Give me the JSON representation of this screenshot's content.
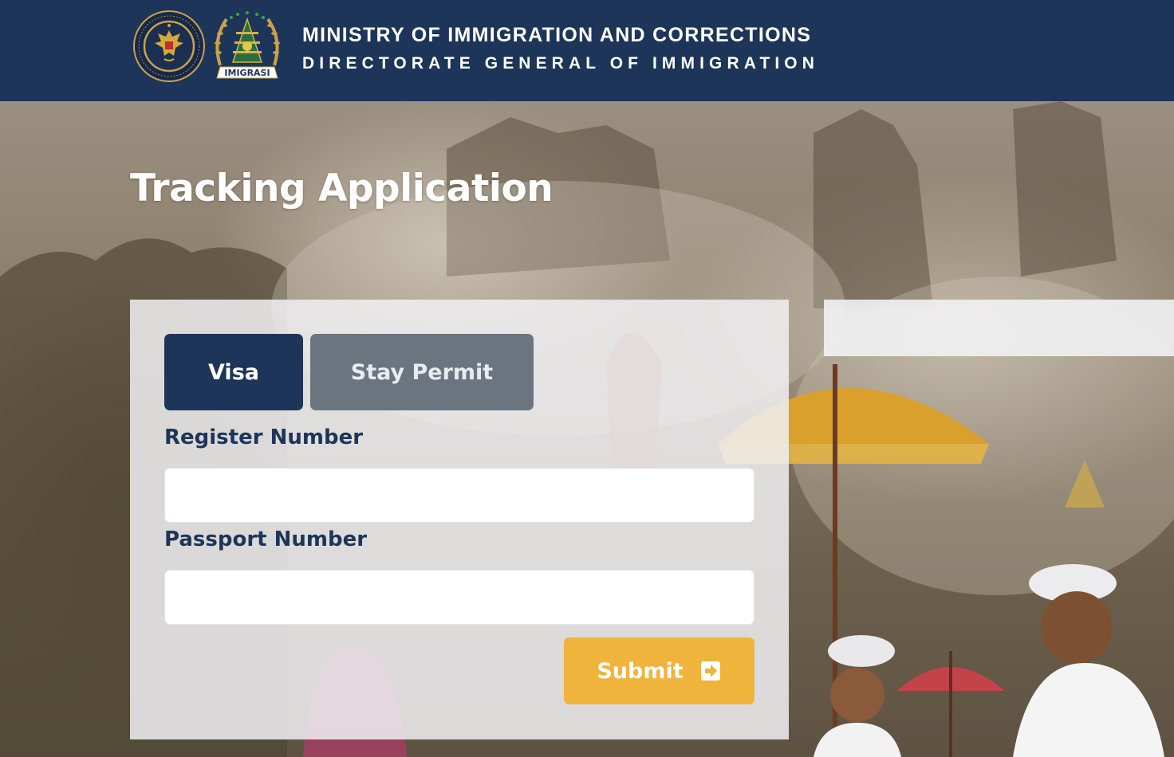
{
  "header": {
    "title": "MINISTRY OF IMMIGRATION AND CORRECTIONS",
    "subtitle": "DIRECTORATE GENERAL OF IMMIGRATION",
    "logos": [
      {
        "icon": "ministry-emblem-icon",
        "text": "REPUBLIK INDONESIA"
      },
      {
        "icon": "imigrasi-emblem-icon",
        "text": "IMIGRASI"
      }
    ],
    "colors": {
      "background": "#1d3558",
      "text": "#ffffff"
    }
  },
  "page": {
    "title": "Tracking Application"
  },
  "form": {
    "tabs": [
      {
        "label": "Visa",
        "active": true
      },
      {
        "label": "Stay Permit",
        "active": false
      }
    ],
    "fields": [
      {
        "label": "Register Number",
        "value": "",
        "placeholder": ""
      },
      {
        "label": "Passport Number",
        "value": "",
        "placeholder": ""
      }
    ],
    "submit": {
      "label": "Submit",
      "icon": "arrow-into-box-icon"
    },
    "colors": {
      "primary": "#1d3558",
      "inactive_tab": "#6b7580",
      "submit": "#f0b33c"
    }
  }
}
